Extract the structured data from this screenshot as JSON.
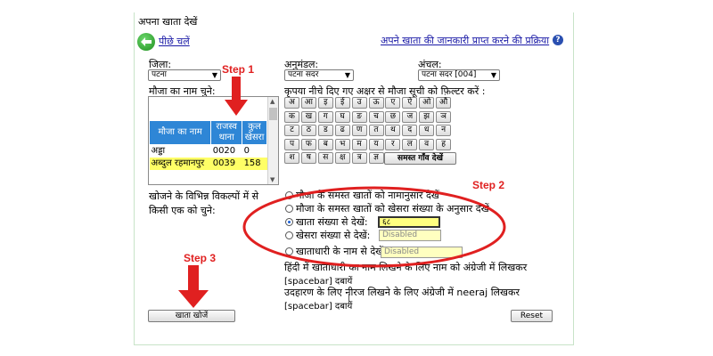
{
  "page": {
    "title": "अपना खाता देखें",
    "back_link": "पीछे चलें",
    "process_link": "अपने खाता की जानकारी प्राप्त करने की प्रक्रिया"
  },
  "filters": {
    "district_label": "जिला:",
    "district_value": "पटना",
    "subdivision_label": "अनुमंडल:",
    "subdivision_value": "पटना सदर",
    "circle_label": "अंचल:",
    "circle_value": "पटना सदर [004]"
  },
  "mouza": {
    "label": "मौजा का नाम चुने:",
    "filter_hint": "कृपया नीचे दिए गए अक्षर से मौजा सूची को फ़िल्टर करें :",
    "columns": [
      "मौजा का नाम",
      "राजस्व थाना",
      "कुल खेसरा"
    ],
    "rows": [
      {
        "name": "अड्डा",
        "thana": "0020",
        "khesra": "0"
      },
      {
        "name": "अब्दुल रहमानपुर",
        "thana": "0039",
        "khesra": "158"
      }
    ]
  },
  "alphabet": {
    "rows": [
      [
        "अ",
        "आ",
        "इ",
        "ई",
        "उ",
        "ऊ",
        "ए",
        "ऐ",
        "ओ",
        "औ"
      ],
      [
        "क",
        "ख",
        "ग",
        "घ",
        "ङ",
        "च",
        "छ",
        "ज",
        "झ",
        "ञ"
      ],
      [
        "ट",
        "ठ",
        "ड",
        "ढ",
        "ण",
        "त",
        "थ",
        "द",
        "ध",
        "न"
      ],
      [
        "प",
        "फ",
        "ब",
        "भ",
        "म",
        "य",
        "र",
        "ल",
        "व",
        "ह"
      ],
      [
        "श",
        "ष",
        "स",
        "क्ष",
        "त्र",
        "ज्ञ"
      ]
    ],
    "all_villages_button": "समस्त गाँव देखें"
  },
  "search": {
    "label_line1": "खोजने के विभिन्न विकल्पों में से",
    "label_line2": "किसी एक को चुने:",
    "options": [
      {
        "label": "मौजा के समस्त खातों को नामानुसार देखें",
        "selected": false
      },
      {
        "label": "मौजा के समस्त खातों को खेसरा संख्या के अनुसार देखें",
        "selected": false
      },
      {
        "label": "खाता संख्या से देखें:",
        "selected": true,
        "value": "६८"
      },
      {
        "label": "खेसरा संख्या से देखें:",
        "selected": false,
        "value": "Disabled"
      },
      {
        "label": "खाताधारी के नाम से देखें:",
        "selected": false,
        "value": "Disabled"
      }
    ],
    "hint1_line1": "हिंदी में खाताधारी का नाम लिखने के लिए नाम को अंग्रेजी में लिखकर",
    "hint1_line2": "[spacebar] दबायें",
    "hint2_line1": "उदहारण के लिए नीरज लिखने के लिए अंग्रेजी में neeraj लिखकर",
    "hint2_line2": "[spacebar] दबायें",
    "submit_button": "खाता खोजें",
    "reset_button": "Reset"
  },
  "annotations": {
    "step1": "Step 1",
    "step2": "Step 2",
    "step3": "Step 3",
    "color": "#e02020"
  }
}
